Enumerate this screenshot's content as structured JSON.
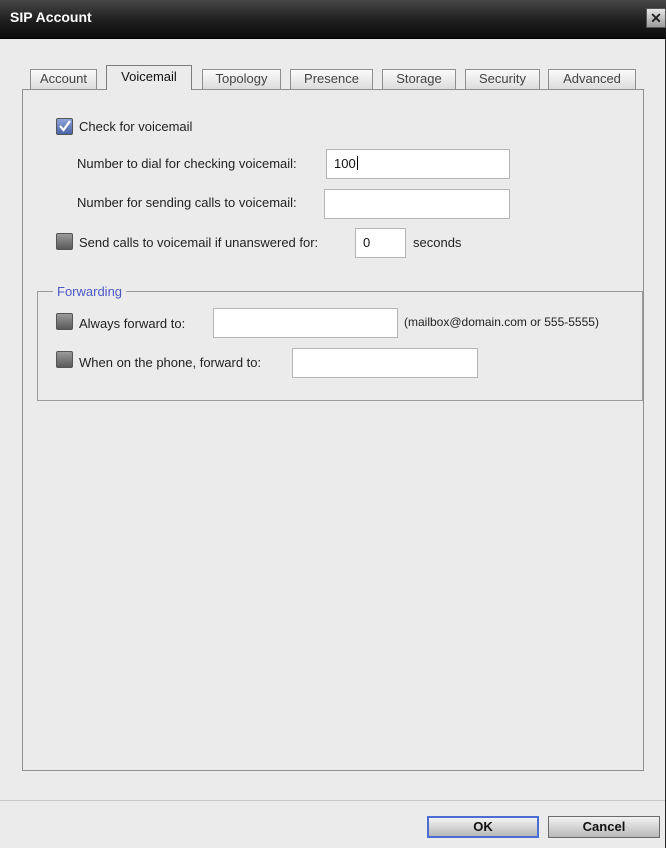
{
  "window": {
    "title": "SIP Account",
    "close_icon": "close-icon"
  },
  "tabs": [
    {
      "label": "Account",
      "active": false
    },
    {
      "label": "Voicemail",
      "active": true
    },
    {
      "label": "Topology",
      "active": false
    },
    {
      "label": "Presence",
      "active": false
    },
    {
      "label": "Storage",
      "active": false
    },
    {
      "label": "Security",
      "active": false
    },
    {
      "label": "Advanced",
      "active": false
    }
  ],
  "voicemail": {
    "check_voicemail": {
      "label": "Check for voicemail",
      "checked": true
    },
    "dial_number": {
      "label": "Number to dial for checking voicemail:",
      "value": "100"
    },
    "send_number": {
      "label": "Number for sending calls to voicemail:",
      "value": ""
    },
    "unanswered": {
      "label": "Send calls to voicemail if unanswered for:",
      "checked": false,
      "value": "0",
      "unit": "seconds"
    }
  },
  "forwarding": {
    "title": "Forwarding",
    "always": {
      "label": "Always forward to:",
      "checked": false,
      "value": "",
      "hint": "(mailbox@domain.com or 555-5555)"
    },
    "on_phone": {
      "label": "When on the phone, forward to:",
      "checked": false,
      "value": ""
    }
  },
  "buttons": {
    "ok": "OK",
    "cancel": "Cancel"
  },
  "colors": {
    "accent": "#4a58c6",
    "checkbox_checked": "#4a63a8",
    "titlebar": "#1e1e1e"
  }
}
